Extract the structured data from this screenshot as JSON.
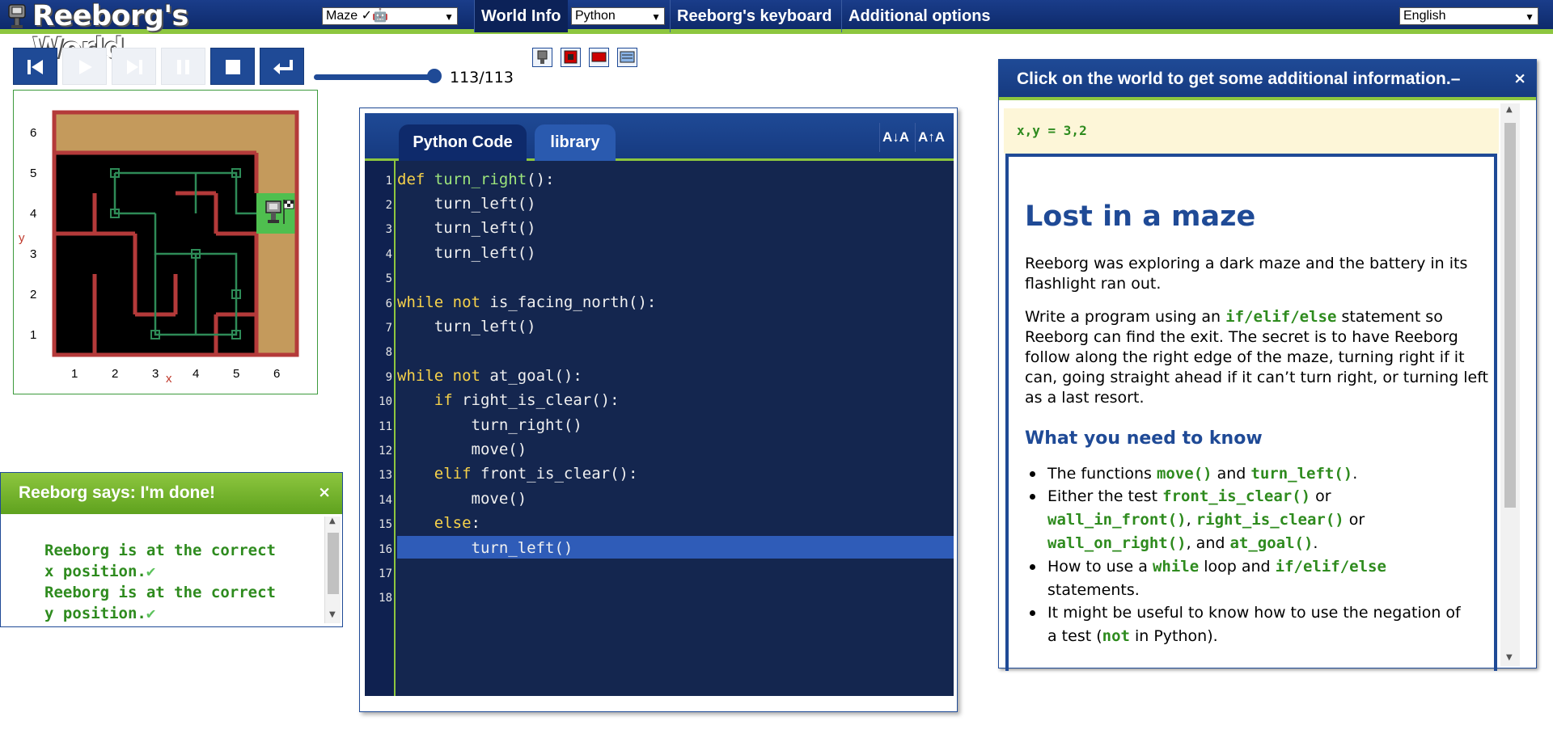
{
  "app": {
    "title": "Reeborg's World"
  },
  "topbar": {
    "world_select": "Maze ✓🤖",
    "world_info": "World Info",
    "language": "Python",
    "keyboard": "Reeborg's keyboard",
    "options": "Additional options",
    "locale": "English"
  },
  "controls": {
    "step_counter": "113/113",
    "progress": 1.0
  },
  "world": {
    "x_ticks": [
      "1",
      "2",
      "3",
      "4",
      "5",
      "6"
    ],
    "y_ticks": [
      "1",
      "2",
      "3",
      "4",
      "5",
      "6"
    ],
    "x_label": "x",
    "y_label": "y"
  },
  "says": {
    "title": "Reeborg says: I'm done!",
    "lines": [
      "Reeborg is at the correct",
      "x position.",
      "Reeborg is at the correct",
      "y position."
    ]
  },
  "editor": {
    "tab_code": "Python Code",
    "tab_library": "library",
    "font_smaller": "A↓A",
    "font_larger": "A↑A",
    "line_numbers": [
      "1",
      "2",
      "3",
      "4",
      "5",
      "6",
      "7",
      "8",
      "9",
      "10",
      "11",
      "12",
      "13",
      "14",
      "15",
      "16",
      "17",
      "18"
    ],
    "highlight_line": "14"
  },
  "info": {
    "header": "Click on the world to get some additional information.–",
    "coords": "x,y = 3,2",
    "title": "Lost in a maze",
    "p1": "Reeborg was exploring a dark maze and the battery in its flashlight ran out.",
    "p2_pre": "Write a program using an ",
    "p2_kw": "if/elif/else",
    "p2_post": " statement so Reeborg can find the exit. The secret is to have Reeborg follow along the right edge of the maze, turning right if it can, going straight ahead if it can’t turn right, or turning left as a last resort.",
    "subtitle": "What you need to know",
    "b1_a": "The functions ",
    "b1_k1": "move()",
    "b1_b": " and ",
    "b1_k2": "turn_left()",
    "b1_c": ".",
    "b2_a": "Either the test ",
    "b2_k1": "front_is_clear()",
    "b2_b": " or ",
    "b2_k2": "wall_in_front()",
    "b2_c": ", ",
    "b2_k3": "right_is_clear()",
    "b2_d": " or ",
    "b2_k4": "wall_on_right()",
    "b2_e": ", and ",
    "b2_k5": "at_goal()",
    "b2_f": ".",
    "b3_a": "How to use a ",
    "b3_k1": "while",
    "b3_b": " loop and ",
    "b3_k2": "if/elif/else",
    "b3_c": " statements.",
    "b4_a": "It might be useful to know how to use the negation of a test (",
    "b4_k1": "not",
    "b4_b": " in Python)."
  },
  "colors": {
    "brand_blue": "#1f4a96",
    "accent_green": "#8dc63f",
    "keyword_yellow": "#f7d24a"
  }
}
